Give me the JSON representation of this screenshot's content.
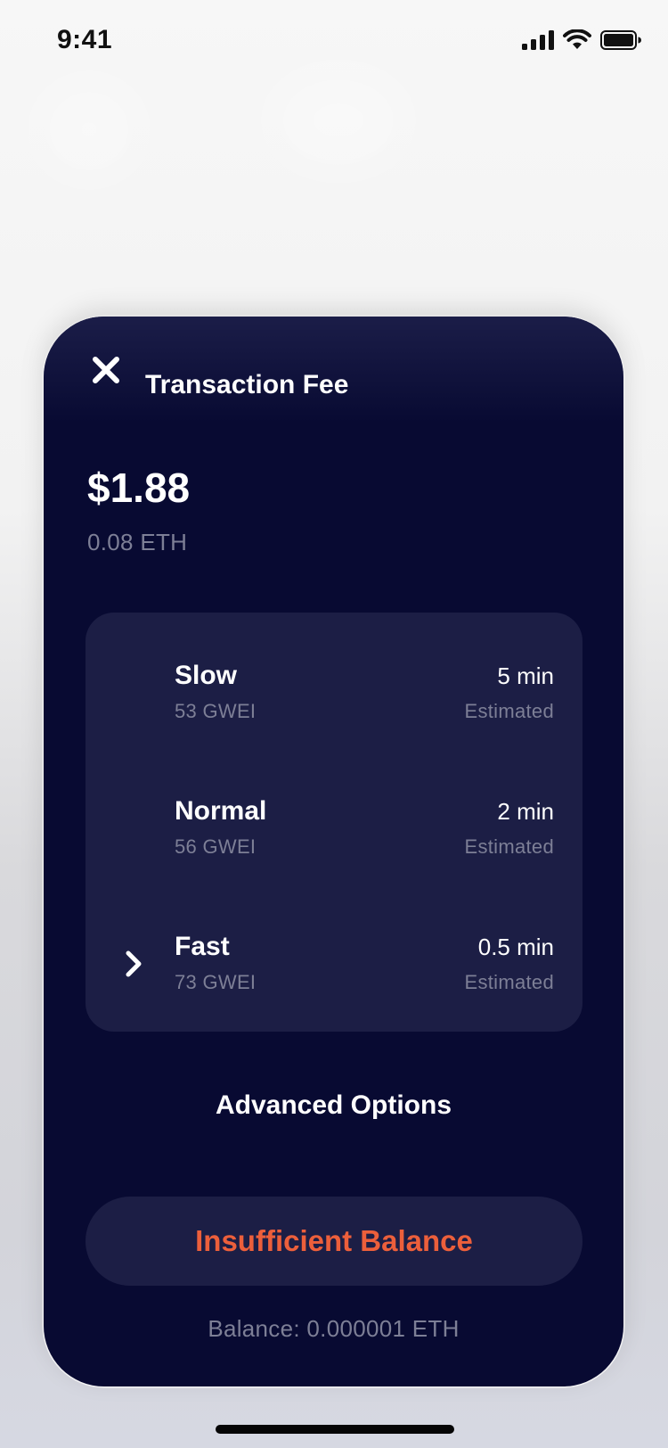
{
  "status_bar": {
    "time": "9:41"
  },
  "sheet": {
    "title": "Transaction Fee",
    "fee_usd": "$1.88",
    "fee_eth": "0.08 ETH",
    "options": [
      {
        "name": "Slow",
        "gwei": "53 GWEI",
        "time": "5 min",
        "estimate_label": "Estimated",
        "selected": false
      },
      {
        "name": "Normal",
        "gwei": "56 GWEI",
        "time": "2 min",
        "estimate_label": "Estimated",
        "selected": false
      },
      {
        "name": "Fast",
        "gwei": "73 GWEI",
        "time": "0.5 min",
        "estimate_label": "Estimated",
        "selected": true
      }
    ],
    "advanced_label": "Advanced Options",
    "cta_label": "Insufficient Balance",
    "balance_text": "Balance: 0.000001 ETH"
  },
  "icons": {
    "close": "close-icon",
    "selected": "chevron-right-icon",
    "signal": "cellular-signal-icon",
    "wifi": "wifi-icon",
    "battery": "battery-icon"
  },
  "colors": {
    "sheet_bg": "#080a32",
    "card_bg": "#1c1e45",
    "muted_text": "#7d7f96",
    "error_text": "#ec5f3b"
  }
}
